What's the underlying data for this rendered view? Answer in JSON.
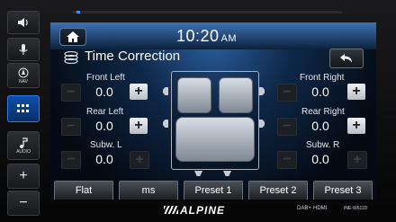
{
  "side_buttons": [
    {
      "id": "voice",
      "label": ""
    },
    {
      "id": "mic",
      "label": ""
    },
    {
      "id": "nav",
      "label": "NAV"
    },
    {
      "id": "menu",
      "label": ""
    },
    {
      "id": "audio",
      "label": "AUDIO"
    },
    {
      "id": "vol_up",
      "label": "+"
    },
    {
      "id": "vol_down",
      "label": "−"
    }
  ],
  "clock": {
    "time": "10:20",
    "ampm": "AM"
  },
  "page_title": "Time Correction",
  "channels": {
    "front_left": {
      "label": "Front Left",
      "value": "0.0"
    },
    "front_right": {
      "label": "Front Right",
      "value": "0.0"
    },
    "rear_left": {
      "label": "Rear Left",
      "value": "0.0"
    },
    "rear_right": {
      "label": "Rear Right",
      "value": "0.0"
    },
    "sub_l": {
      "label": "Subw. L",
      "value": "0.0"
    },
    "sub_r": {
      "label": "Subw. R",
      "value": "0.0"
    }
  },
  "controls": {
    "plus": "+",
    "minus": "−"
  },
  "tabs": [
    "Flat",
    "ms",
    "Preset 1",
    "Preset 2",
    "Preset 3"
  ],
  "footer": {
    "brand": "ALPINE",
    "dab": "DAB+",
    "hdmi": "HDMI",
    "model": "INE-W611D"
  },
  "colors": {
    "accent": "#2e7bf0",
    "screen_bg": "#0e2747"
  }
}
